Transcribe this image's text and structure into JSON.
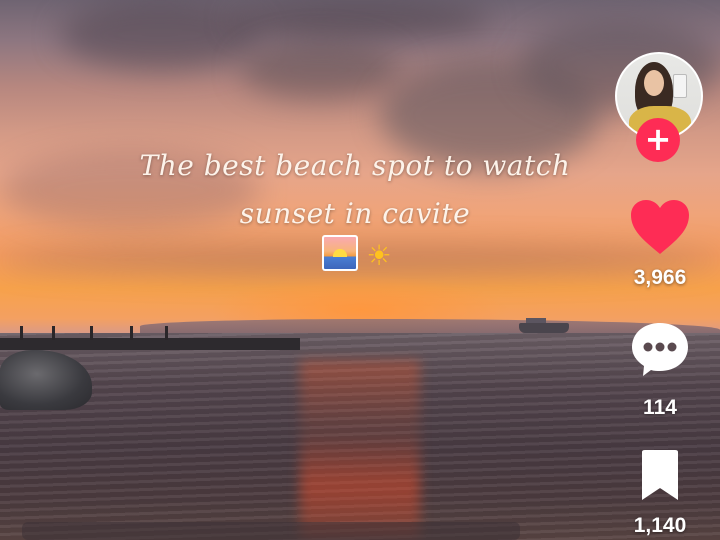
{
  "video": {
    "caption_lines": [
      "The best beach spot to watch",
      "sunset in cavite"
    ],
    "caption_emojis": [
      "sunrise-emoji",
      "sun-emoji"
    ],
    "sun_glyph": "☀"
  },
  "sidebar": {
    "follow_label": "+",
    "likes": "3,966",
    "comments": "114",
    "bookmarks": "1,140"
  },
  "colors": {
    "follow_red": "#fe2c55",
    "like_red": "#fe2c55",
    "icon_white": "#ffffff"
  }
}
